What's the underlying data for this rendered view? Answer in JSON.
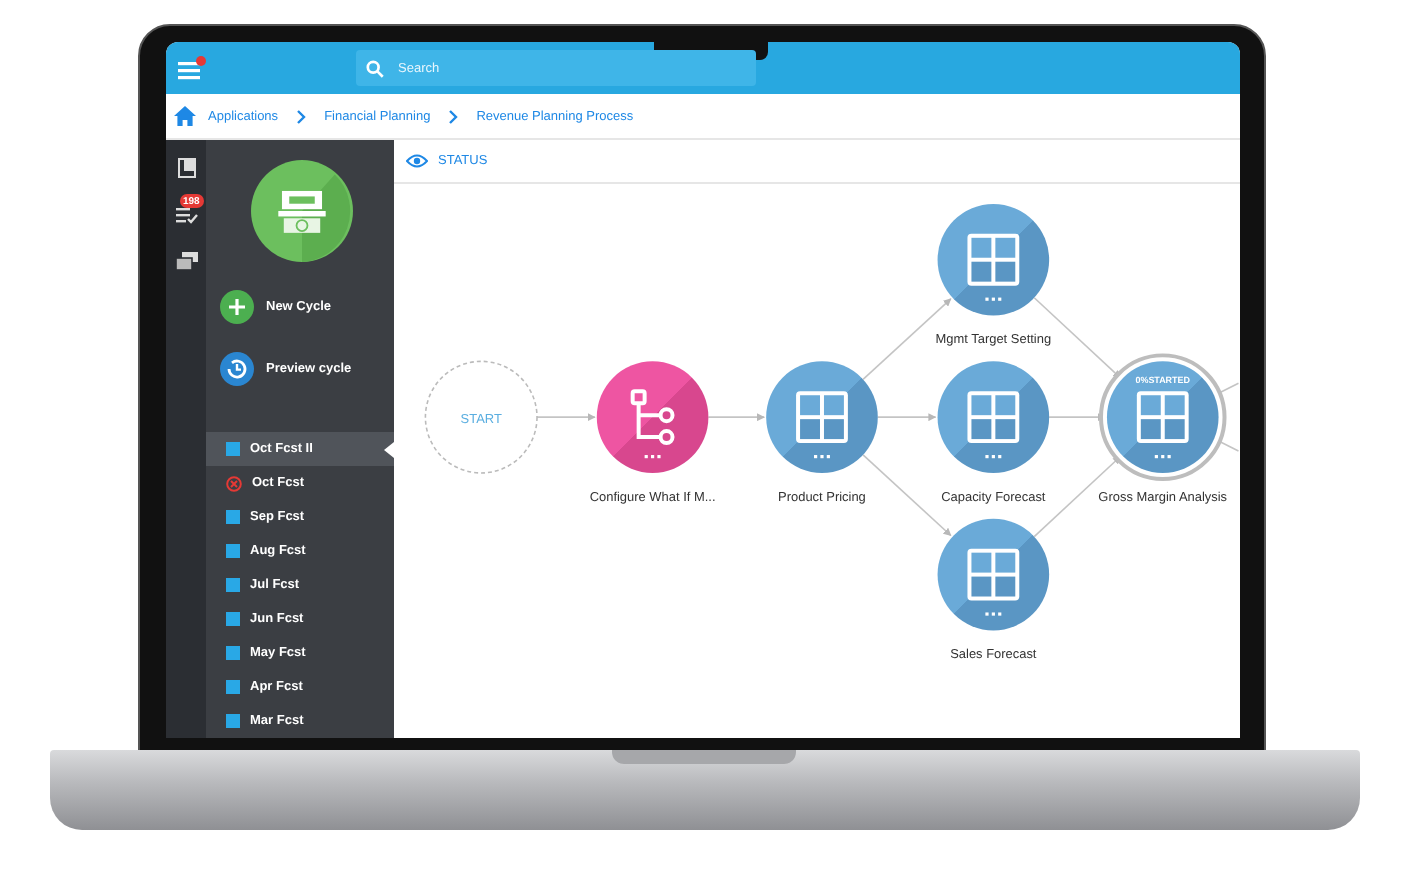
{
  "header": {
    "search": {
      "placeholder": "Search"
    }
  },
  "breadcrumb": [
    "Applications",
    "Financial Planning",
    "Revenue Planning Process"
  ],
  "rail": {
    "badge": "198"
  },
  "sidebar": {
    "actions": [
      {
        "label": "New Cycle",
        "kind": "new"
      },
      {
        "label": "Preview cycle",
        "kind": "preview"
      }
    ],
    "cycles": [
      {
        "label": "Oct Fcst II",
        "selected": true,
        "kind": "ok"
      },
      {
        "label": "Oct Fcst",
        "selected": false,
        "kind": "error"
      },
      {
        "label": "Sep Fcst",
        "selected": false,
        "kind": "ok"
      },
      {
        "label": "Aug Fcst",
        "selected": false,
        "kind": "ok"
      },
      {
        "label": "Jul Fcst",
        "selected": false,
        "kind": "ok"
      },
      {
        "label": "Jun Fcst",
        "selected": false,
        "kind": "ok"
      },
      {
        "label": "May Fcst",
        "selected": false,
        "kind": "ok"
      },
      {
        "label": "Apr Fcst",
        "selected": false,
        "kind": "ok"
      },
      {
        "label": "Mar Fcst",
        "selected": false,
        "kind": "ok"
      }
    ]
  },
  "status": {
    "title": "STATUS"
  },
  "diagram": {
    "nodes": [
      {
        "kind": "start",
        "label": "START"
      },
      {
        "kind": "whatif",
        "label": "Configure What If M..."
      },
      {
        "kind": "task",
        "label": "Product Pricing"
      },
      {
        "kind": "task",
        "label": "Mgmt Target Setting"
      },
      {
        "kind": "task",
        "label": "Capacity Forecast"
      },
      {
        "kind": "task",
        "label": "Sales Forecast"
      },
      {
        "kind": "task",
        "label": "Gross Margin Analysis",
        "status": "0%STARTED",
        "selected": true
      }
    ]
  }
}
